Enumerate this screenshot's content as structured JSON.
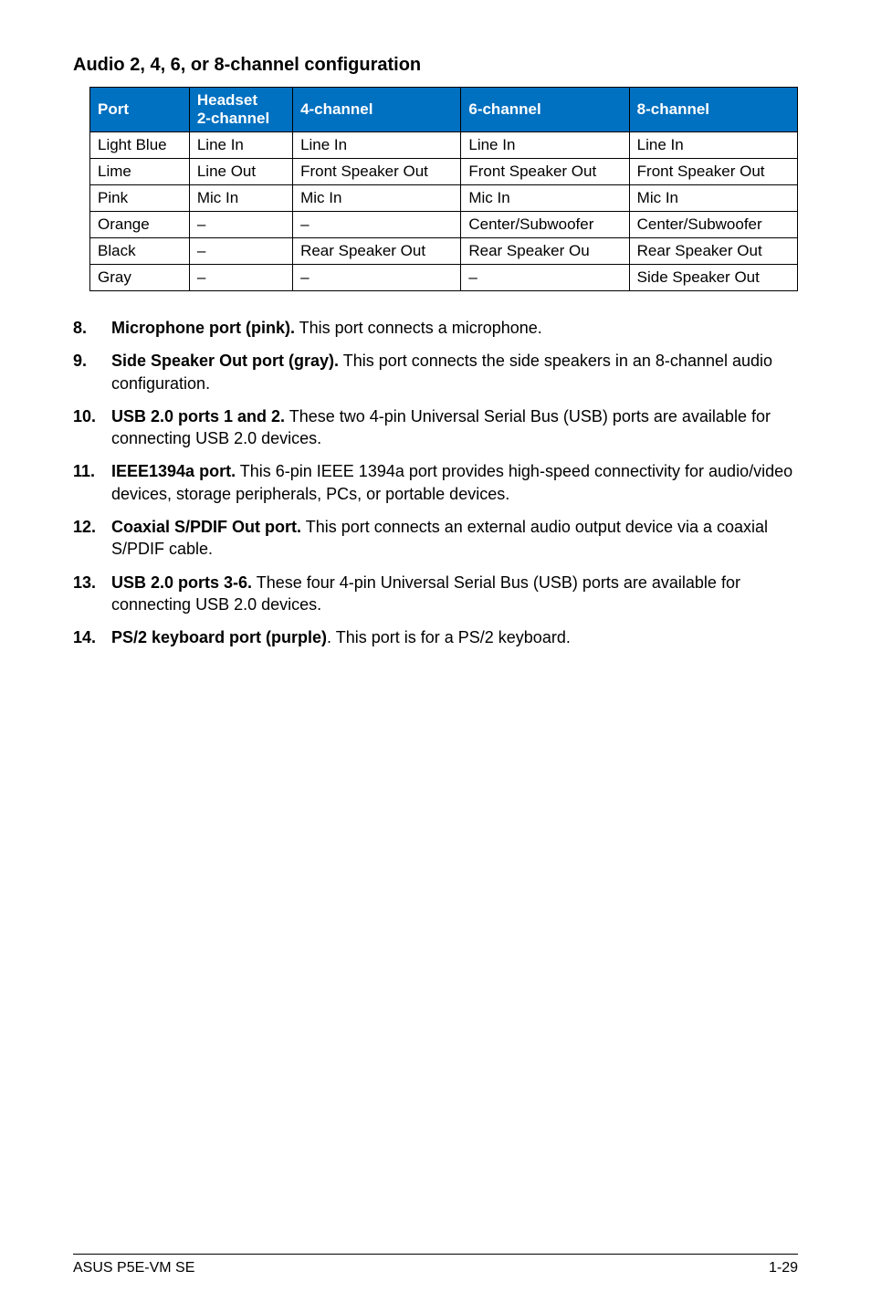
{
  "section_title": "Audio 2, 4, 6, or 8-channel configuration",
  "table": {
    "headers": {
      "port": "Port",
      "headset_line1": "Headset",
      "headset_line2": "2-channel",
      "ch4": "4-channel",
      "ch6": "6-channel",
      "ch8": "8-channel"
    },
    "rows": [
      {
        "port": "Light Blue",
        "h2": "Line In",
        "h4": "Line In",
        "h6": "Line In",
        "h8": "Line In"
      },
      {
        "port": "Lime",
        "h2": "Line Out",
        "h4": "Front Speaker Out",
        "h6": "Front Speaker Out",
        "h8": "Front Speaker Out"
      },
      {
        "port": "Pink",
        "h2": "Mic In",
        "h4": "Mic In",
        "h6": "Mic In",
        "h8": "Mic In"
      },
      {
        "port": "Orange",
        "h2": "–",
        "h4": "–",
        "h6": "Center/Subwoofer",
        "h8": "Center/Subwoofer"
      },
      {
        "port": "Black",
        "h2": "–",
        "h4": "Rear Speaker Out",
        "h6": "Rear Speaker Ou",
        "h8": "Rear Speaker Out"
      },
      {
        "port": "Gray",
        "h2": "–",
        "h4": "–",
        "h6": "–",
        "h8": "Side Speaker Out"
      }
    ]
  },
  "items": [
    {
      "num": "8.",
      "lead": "Microphone port (pink).",
      "text": " This port connects a microphone."
    },
    {
      "num": "9.",
      "lead": "Side Speaker Out port (gray).",
      "text": " This port connects the side speakers in an 8-channel audio configuration."
    },
    {
      "num": "10.",
      "lead": "USB 2.0 ports 1 and 2.",
      "text": " These two 4-pin Universal Serial Bus (USB) ports are available for connecting USB 2.0 devices."
    },
    {
      "num": "11.",
      "lead": "IEEE1394a port.",
      "text": " This 6-pin IEEE 1394a port provides high-speed connectivity for audio/video devices, storage peripherals, PCs, or portable devices."
    },
    {
      "num": "12.",
      "lead": "Coaxial S/PDIF Out port.",
      "text": " This port connects an external audio output device via a coaxial S/PDIF cable."
    },
    {
      "num": "13.",
      "lead": "USB 2.0 ports 3-6.",
      "text": " These four 4-pin Universal Serial Bus (USB) ports are available for connecting USB 2.0 devices."
    },
    {
      "num": "14.",
      "lead": "PS/2 keyboard port (purple)",
      "text": ". This port is for a PS/2 keyboard."
    }
  ],
  "footer": {
    "left": "ASUS P5E-VM SE",
    "right": "1-29"
  }
}
